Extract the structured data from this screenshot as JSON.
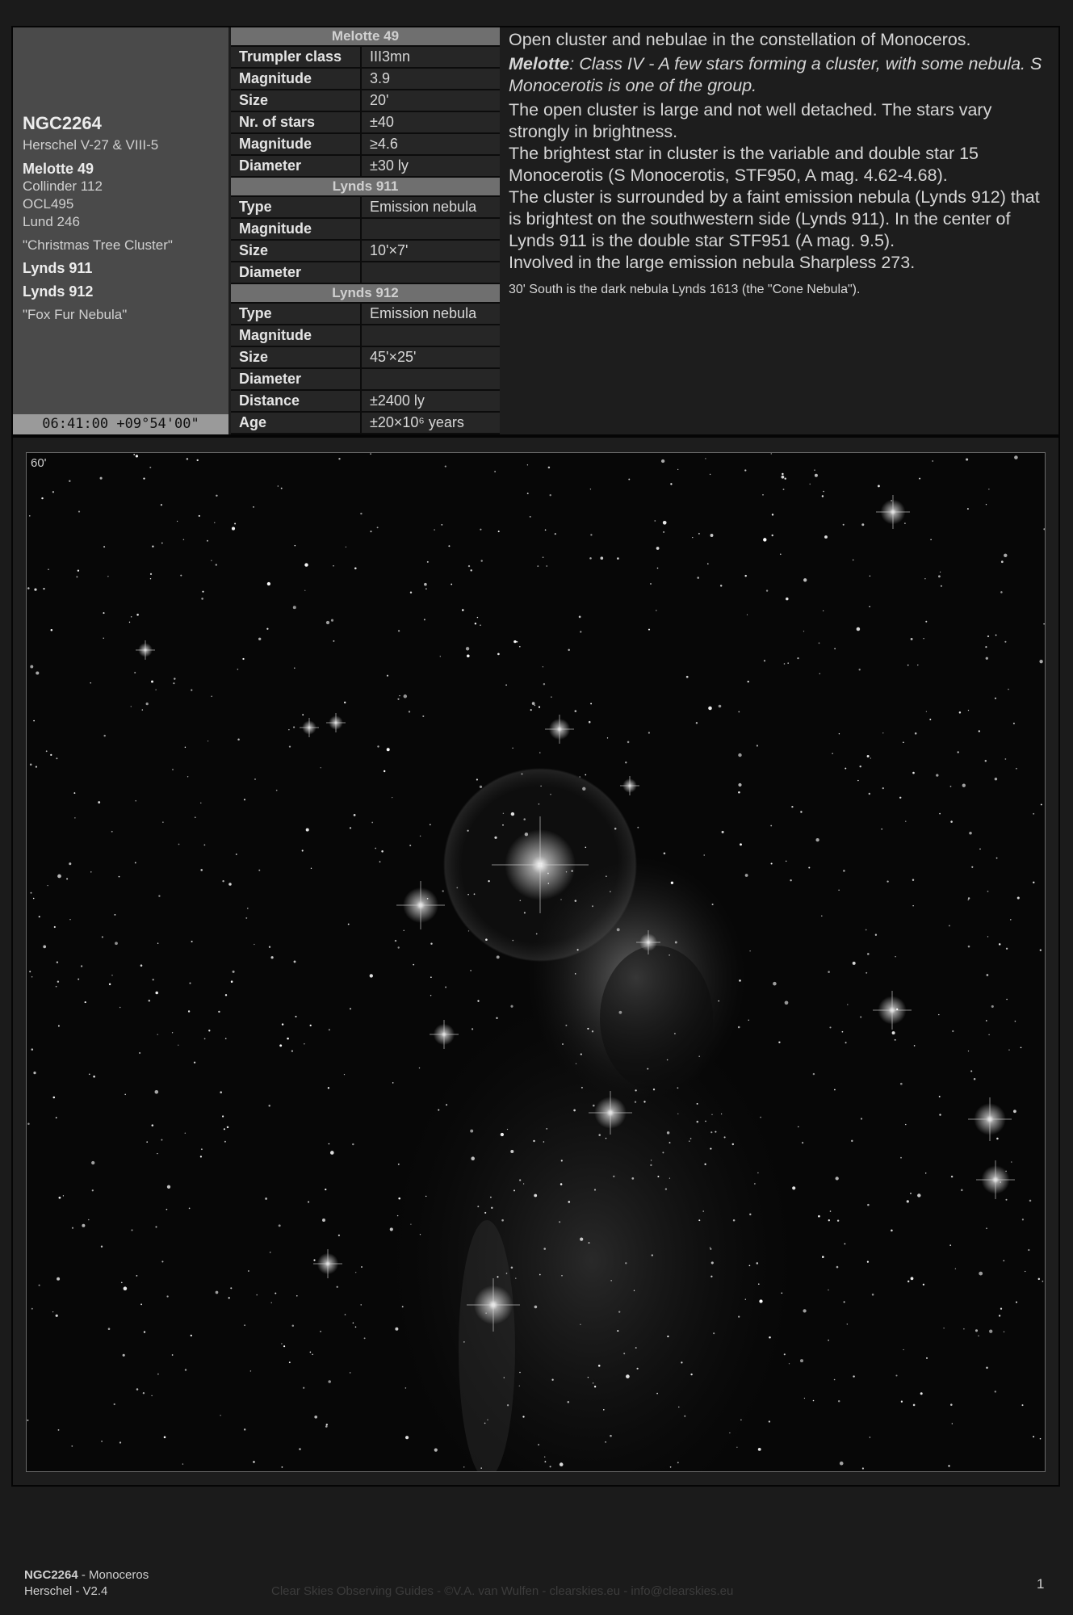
{
  "object": {
    "name": "NGC2264",
    "herschel": "Herschel V-27 & VIII-5",
    "melotte": "Melotte 49",
    "collinder": "Collinder 112",
    "ocl": "OCL495",
    "lund": "Lund 246",
    "nickname1": "\"Christmas Tree Cluster\"",
    "lynds911": "Lynds 911",
    "lynds912": "Lynds 912",
    "nickname2": "\"Fox Fur Nebula\"",
    "coordinates": "06:41:00 +09°54'00\""
  },
  "tables": [
    {
      "title": "Melotte 49",
      "rows": [
        {
          "k": "Trumpler class",
          "v": "III3mn"
        },
        {
          "k": "Magnitude",
          "v": "3.9"
        },
        {
          "k": "Size",
          "v": "20'"
        },
        {
          "k": "Nr. of stars",
          "v": "±40"
        },
        {
          "k": "Magnitude",
          "v": "≥4.6"
        },
        {
          "k": "Diameter",
          "v": "±30 ly"
        }
      ]
    },
    {
      "title": "Lynds 911",
      "rows": [
        {
          "k": "Type",
          "v": "Emission nebula"
        },
        {
          "k": "Magnitude",
          "v": ""
        },
        {
          "k": "Size",
          "v": "10'×7'"
        },
        {
          "k": "Diameter",
          "v": ""
        }
      ]
    },
    {
      "title": "Lynds 912",
      "rows": [
        {
          "k": "Type",
          "v": "Emission nebula"
        },
        {
          "k": "Magnitude",
          "v": ""
        },
        {
          "k": "Size",
          "v": "45'×25'"
        },
        {
          "k": "Diameter",
          "v": ""
        },
        {
          "k": "Distance",
          "v": "±2400 ly"
        },
        {
          "k": "Age",
          "v": "±20×10⁶ years"
        }
      ]
    }
  ],
  "description": {
    "p1": "Open cluster and nebulae in the constellation of Monoceros.",
    "melotte_label": "Melotte",
    "melotte_text": ": Class IV - A few stars forming a cluster, with some nebula. S Monocerotis is one of the group.",
    "p2": "The open cluster is large and not well detached. The stars vary strongly in brightness.",
    "p3": "The brightest star in cluster is the variable and double star 15 Monocerotis (S Monocerotis, STF950, A mag. 4.62-4.68).",
    "p4": "The cluster is surrounded by a faint emission nebula (Lynds 912) that is brightest on the southwestern side (Lynds 911). In the center of Lynds 911 is the double star STF951 (A mag. 9.5).",
    "p5": "Involved in the large emission nebula Sharpless 273.",
    "p6": "30' South is the dark nebula Lynds 1613 (the \"Cone Nebula\")."
  },
  "image": {
    "fov": "60'"
  },
  "footer": {
    "name": "NGC2264",
    "constellation": " - Monoceros",
    "catalog": "Herschel - V2.4",
    "credit": "Clear Skies Observing Guides - ©V.A. van Wulfen - clearskies.eu - info@clearskies.eu",
    "page": "1"
  }
}
